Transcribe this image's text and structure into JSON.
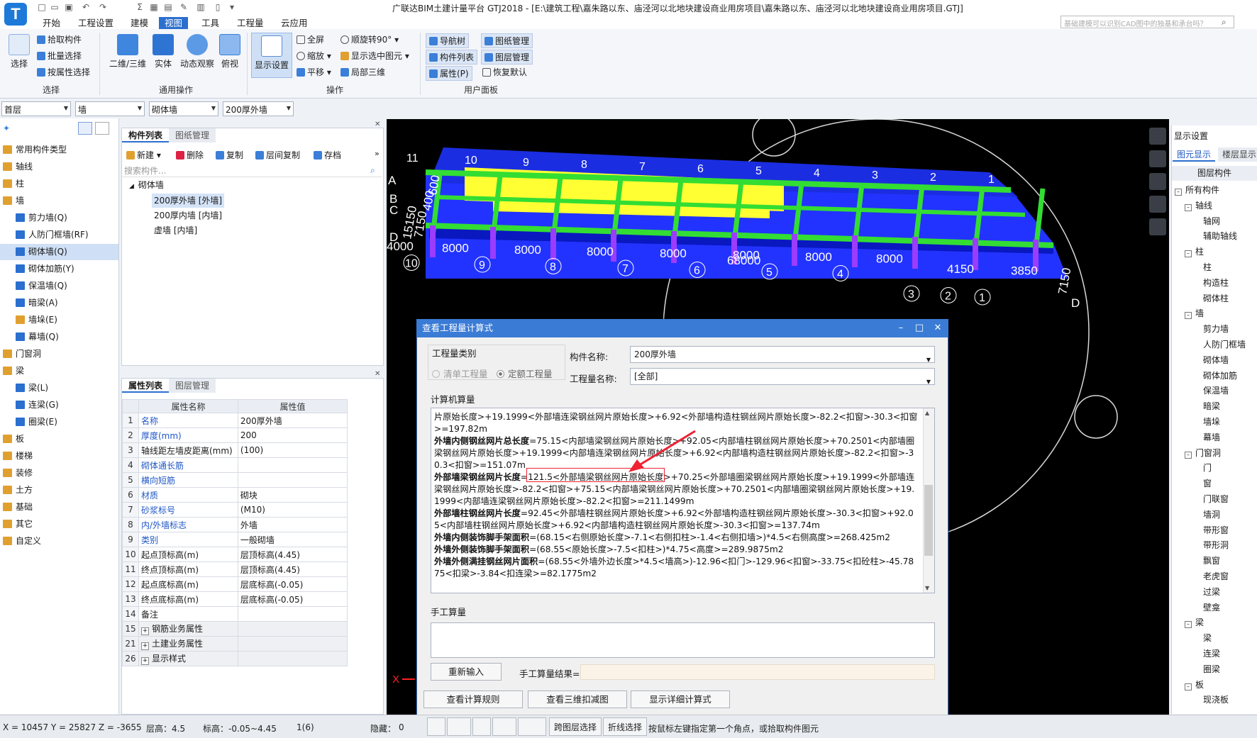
{
  "window": {
    "title": "广联达BIM土建计量平台 GTJ2018 - [E:\\建筑工程\\嘉朱路以东、庙泾河以北地块建设商业用房项目\\嘉朱路以东、庙泾河以北地块建设商业用房项目.GTJ]",
    "search_placeholder": "基础建模可以识别CAD图中的独基和承台吗？",
    "logo": "T"
  },
  "menu_tabs": [
    "开始",
    "工程设置",
    "建模",
    "视图",
    "工具",
    "工程量",
    "云应用"
  ],
  "ribbon": {
    "select_big": "选择",
    "pick": "拾取构件",
    "batch": "批量选择",
    "by_attr": "按属性选择",
    "group_select": "选择",
    "b2d3d": "二维/三维",
    "solid": "实体",
    "dynamic": "动态观察",
    "top_view": "俯视",
    "group_common": "通用操作",
    "display_settings": "显示设置",
    "fullscreen": "全屏",
    "zoom": "缩放",
    "pan": "平移",
    "rotate": "顺旋转90°",
    "show_selected": "显示选中图元",
    "local3d": "局部三维",
    "group_ops": "操作",
    "navtree": "导航树",
    "complist": "构件列表",
    "properties": "属性(P)",
    "drawing_mgmt": "图纸管理",
    "layer_mgmt": "图层管理",
    "restore": "恢复默认",
    "group_user": "用户面板"
  },
  "selectors": [
    "首层",
    "墙",
    "砌体墙",
    "200厚外墙"
  ],
  "left_tree": [
    {
      "label": "常用构件类型",
      "level": 1,
      "color": "#e0a030"
    },
    {
      "label": "轴线",
      "level": 1,
      "color": "#e0a030"
    },
    {
      "label": "柱",
      "level": 1,
      "color": "#e0a030"
    },
    {
      "label": "墙",
      "level": 1,
      "color": "#e0a030"
    },
    {
      "label": "剪力墙(Q)",
      "level": 2,
      "color": "#2b6fcf"
    },
    {
      "label": "人防门框墙(RF)",
      "level": 2,
      "color": "#2b6fcf"
    },
    {
      "label": "砌体墙(Q)",
      "level": 2,
      "color": "#2b6fcf",
      "selected": true
    },
    {
      "label": "砌体加筋(Y)",
      "level": 2,
      "color": "#2b6fcf"
    },
    {
      "label": "保温墙(Q)",
      "level": 2,
      "color": "#2b6fcf"
    },
    {
      "label": "暗梁(A)",
      "level": 2,
      "color": "#2b6fcf"
    },
    {
      "label": "墙垛(E)",
      "level": 2,
      "color": "#e0a030"
    },
    {
      "label": "幕墙(Q)",
      "level": 2,
      "color": "#2b6fcf"
    },
    {
      "label": "门窗洞",
      "level": 1,
      "color": "#e0a030"
    },
    {
      "label": "梁",
      "level": 1,
      "color": "#e0a030"
    },
    {
      "label": "梁(L)",
      "level": 2,
      "color": "#2b6fcf"
    },
    {
      "label": "连梁(G)",
      "level": 2,
      "color": "#2b6fcf"
    },
    {
      "label": "圈梁(E)",
      "level": 2,
      "color": "#2b6fcf"
    },
    {
      "label": "板",
      "level": 1,
      "color": "#e0a030"
    },
    {
      "label": "楼梯",
      "level": 1,
      "color": "#e0a030"
    },
    {
      "label": "装修",
      "level": 1,
      "color": "#e0a030"
    },
    {
      "label": "土方",
      "level": 1,
      "color": "#e0a030"
    },
    {
      "label": "基础",
      "level": 1,
      "color": "#e0a030"
    },
    {
      "label": "其它",
      "level": 1,
      "color": "#e0a030"
    },
    {
      "label": "自定义",
      "level": 1,
      "color": "#e0a030"
    }
  ],
  "comp_panel": {
    "tabs": [
      "构件列表",
      "图纸管理"
    ],
    "tools": [
      "新建",
      "删除",
      "复制",
      "层间复制",
      "存档"
    ],
    "search_placeholder": "搜索构件...",
    "root": "砌体墙",
    "items": [
      "200厚外墙 [外墙]",
      "200厚内墙 [内墙]",
      "虚墙 [内墙]"
    ]
  },
  "prop_panel": {
    "tabs": [
      "属性列表",
      "图层管理"
    ],
    "headers": [
      "属性名称",
      "属性值"
    ],
    "rows": [
      {
        "n": "1",
        "name": "名称",
        "value": "200厚外墙",
        "blue": true
      },
      {
        "n": "2",
        "name": "厚度(mm)",
        "value": "200",
        "blue": true
      },
      {
        "n": "3",
        "name": "轴线距左墙皮距离(mm)",
        "value": "(100)",
        "blue": false
      },
      {
        "n": "4",
        "name": "砌体通长筋",
        "value": "",
        "blue": true
      },
      {
        "n": "5",
        "name": "横向短筋",
        "value": "",
        "blue": true
      },
      {
        "n": "6",
        "name": "材质",
        "value": "砌块",
        "blue": true
      },
      {
        "n": "7",
        "name": "砂浆标号",
        "value": "(M10)",
        "blue": true
      },
      {
        "n": "8",
        "name": "内/外墙标志",
        "value": "外墙",
        "blue": true
      },
      {
        "n": "9",
        "name": "类别",
        "value": "一般砌墙",
        "blue": true
      },
      {
        "n": "10",
        "name": "起点顶标高(m)",
        "value": "层顶标高(4.45)",
        "blue": false
      },
      {
        "n": "11",
        "name": "终点顶标高(m)",
        "value": "层顶标高(4.45)",
        "blue": false
      },
      {
        "n": "12",
        "name": "起点底标高(m)",
        "value": "层底标高(-0.05)",
        "blue": false
      },
      {
        "n": "13",
        "name": "终点底标高(m)",
        "value": "层底标高(-0.05)",
        "blue": false
      },
      {
        "n": "14",
        "name": "备注",
        "value": "",
        "blue": false
      },
      {
        "n": "15",
        "name": "钢筋业务属性",
        "value": "",
        "blue": false,
        "group": true
      },
      {
        "n": "21",
        "name": "土建业务属性",
        "value": "",
        "blue": false,
        "group": true
      },
      {
        "n": "26",
        "name": "显示样式",
        "value": "",
        "blue": false,
        "group": true
      }
    ]
  },
  "viewport": {
    "axis_top_left": [
      "A",
      "B",
      "C",
      "D"
    ],
    "dim_bottom": [
      "4000",
      "8000",
      "8000",
      "8000",
      "8000",
      "8000",
      "8000",
      "8000",
      "4150",
      "3850"
    ],
    "axis_bottom": [
      "11",
      "10",
      "9",
      "8",
      "7",
      "6",
      "5",
      "4",
      "3",
      "2",
      "1"
    ],
    "axis_top": [
      "11",
      "10",
      "9",
      "8",
      "7",
      "6",
      "5",
      "4",
      "3",
      "2",
      "1"
    ],
    "labels_left": [
      "15150",
      "7150",
      "400",
      "600"
    ],
    "label_mid": "68000",
    "label_right": "7150",
    "axis_right_d": "D",
    "x_marker": "X"
  },
  "right_panel": {
    "title": "显示设置",
    "tabs": [
      "图元显示",
      "楼层显示"
    ],
    "header": "图层构件",
    "items": [
      {
        "label": "所有构件",
        "type": "root"
      },
      {
        "label": "轴线",
        "type": "g"
      },
      {
        "label": "轴网",
        "type": "c"
      },
      {
        "label": "辅助轴线",
        "type": "c"
      },
      {
        "label": "柱",
        "type": "g"
      },
      {
        "label": "柱",
        "type": "c"
      },
      {
        "label": "构造柱",
        "type": "c"
      },
      {
        "label": "砌体柱",
        "type": "c"
      },
      {
        "label": "墙",
        "type": "g"
      },
      {
        "label": "剪力墙",
        "type": "c"
      },
      {
        "label": "人防门框墙",
        "type": "c"
      },
      {
        "label": "砌体墙",
        "type": "c"
      },
      {
        "label": "砌体加筋",
        "type": "c"
      },
      {
        "label": "保温墙",
        "type": "c"
      },
      {
        "label": "暗梁",
        "type": "c"
      },
      {
        "label": "墙垛",
        "type": "c"
      },
      {
        "label": "幕墙",
        "type": "c"
      },
      {
        "label": "门窗洞",
        "type": "g"
      },
      {
        "label": "门",
        "type": "c"
      },
      {
        "label": "窗",
        "type": "c"
      },
      {
        "label": "门联窗",
        "type": "c"
      },
      {
        "label": "墙洞",
        "type": "c"
      },
      {
        "label": "带形窗",
        "type": "c"
      },
      {
        "label": "带形洞",
        "type": "c"
      },
      {
        "label": "飘窗",
        "type": "c"
      },
      {
        "label": "老虎窗",
        "type": "c"
      },
      {
        "label": "过梁",
        "type": "c"
      },
      {
        "label": "壁龛",
        "type": "c"
      },
      {
        "label": "梁",
        "type": "g"
      },
      {
        "label": "梁",
        "type": "c"
      },
      {
        "label": "连梁",
        "type": "c"
      },
      {
        "label": "圈梁",
        "type": "c"
      },
      {
        "label": "板",
        "type": "g"
      },
      {
        "label": "现浇板",
        "type": "c"
      }
    ]
  },
  "dialog": {
    "title": "查看工程量计算式",
    "qty_category": "工程量类别",
    "radio1": "清单工程量",
    "radio2": "定额工程量",
    "comp_name_label": "构件名称:",
    "comp_name_value": "200厚外墙",
    "qty_name_label": "工程量名称:",
    "qty_name_value": "[全部]",
    "computer_calc": "计算机算量",
    "formula": [
      {
        "k": "",
        "v": "片原始长度>+19.1999<外部墙连梁钢丝网片原始长度>+6.92<外部墙构造柱钢丝网片原始长度>-82.2<扣窗>-30.3<扣窗>=197.82m"
      },
      {
        "k": "外墙内侧钢丝网片总长度",
        "v": "=75.15<内部墙梁钢丝网片原始长度>+92.05<内部墙柱钢丝网片原始长度>+70.2501<内部墙圈梁钢丝网片原始长度>+19.1999<内部墙连梁钢丝网片原始长度>+6.92<内部墙构造柱钢丝网片原始长度>-82.2<扣窗>-30.3<扣窗>=151.07m"
      },
      {
        "k": "外部墙梁钢丝网片长度",
        "v": "=121.5<外部墙梁钢丝网片原始长度>+70.25<外部墙圈梁钢丝网片原始长度>+19.1999<外部墙连梁钢丝网片原始长度>-82.2<扣窗>+75.15<内部墙梁钢丝网片原始长度>+70.2501<内部墙圈梁钢丝网片原始长度>+19.1999<内部墙连梁钢丝网片原始长度>-82.2<扣窗>=211.1499m"
      },
      {
        "k": "外部墙柱钢丝网片长度",
        "v": "=92.45<外部墙柱钢丝网片原始长度>+6.92<外部墙构造柱钢丝网片原始长度>-30.3<扣窗>+92.05<内部墙柱钢丝网片原始长度>+6.92<内部墙构造柱钢丝网片原始长度>-30.3<扣窗>=137.74m"
      },
      {
        "k": "外墙内侧装饰脚手架面积",
        "v": "=(68.15<右侧原始长度>-7.1<右侧扣柱>-1.4<右侧扣墙>)*4.5<右侧高度>=268.425m2"
      },
      {
        "k": "外墙外侧装饰脚手架面积",
        "v": "=(68.55<原始长度>-7.5<扣柱>)*4.75<高度>=289.9875m2"
      },
      {
        "k": "外墙外侧满挂钢丝网片面积",
        "v": "=(68.55<外墙外边长度>*4.5<墙高>)-12.96<扣门>-129.96<扣窗>-33.75<扣砼柱>-45.7875<扣梁>-3.84<扣连梁>=82.1775m2"
      }
    ],
    "manual_calc": "手工算量",
    "reinput": "重新输入",
    "manual_result_label": "手工算量结果=",
    "btn_rules": "查看计算规则",
    "btn_3d": "查看三维扣减图",
    "btn_detail": "显示详细计算式"
  },
  "status": {
    "coords": "X = 10457 Y = 25827 Z = -3655",
    "floor_height": "层高：4.5",
    "elevation": "标高：-0.05~4.45",
    "count": "1(6)",
    "hidden": "隐藏：",
    "hidden_count": "0",
    "cross_floor": "跨图层选择",
    "polyline": "折线选择",
    "hint": "按鼠标左键指定第一个角点，或拾取构件图元"
  }
}
